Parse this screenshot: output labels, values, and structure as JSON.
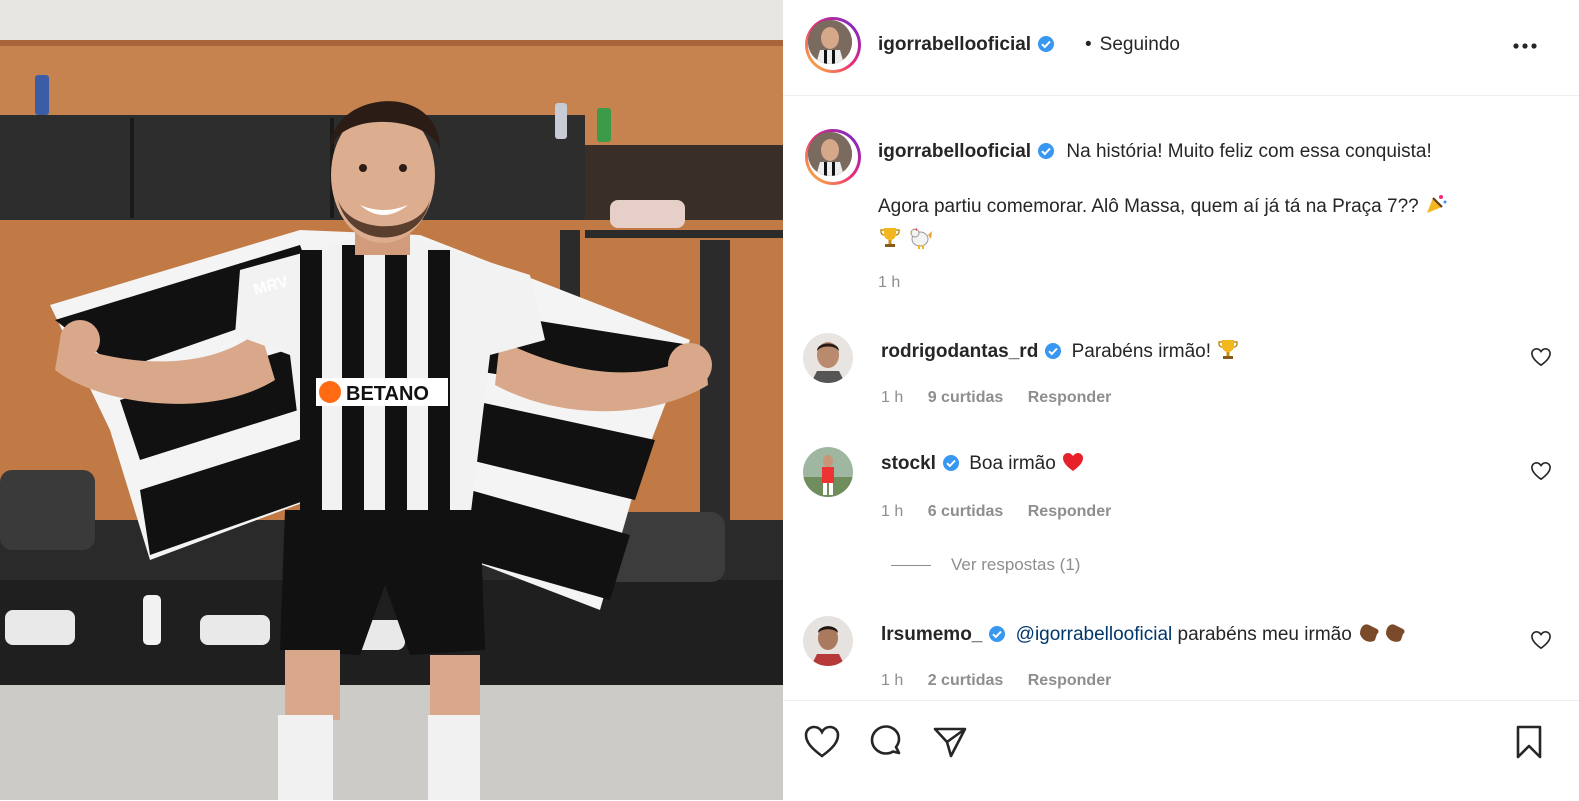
{
  "post": {
    "author": "igorrabellooficial",
    "follow_status": "Seguindo",
    "dot": "•",
    "caption_line1": "Na história! Muito feliz com essa conquista!",
    "caption_line2": "Agora partiu comemorar. Alô Massa, quem aí já tá na Praça 7??",
    "caption_emojis": [
      "party-popper-icon",
      "trophy-icon",
      "rooster-icon"
    ],
    "time": "1 h"
  },
  "photo": {
    "description_icon": "photo-icon",
    "jersey_brand": "BETANO",
    "sleeve_brand": "MRV"
  },
  "comments": [
    {
      "user": "rodrigodantas_rd",
      "text": "Parabéns irmão!",
      "emoji": "trophy-icon",
      "time": "1 h",
      "likes": "9 curtidas",
      "reply": "Responder"
    },
    {
      "user": "stockl",
      "text": "Boa irmão",
      "emoji": "red-heart-icon",
      "time": "1 h",
      "likes": "6 curtidas",
      "reply": "Responder"
    },
    {
      "user": "lrsumemo_",
      "mention": "@igorrabellooficial",
      "text": "parabéns meu irmão",
      "emoji": "clapping-hands-icon",
      "time": "1 h",
      "likes": "2 curtidas",
      "reply": "Responder"
    }
  ],
  "view_replies": "Ver respostas (1)",
  "colors": {
    "verified": "#3897f0",
    "mention": "#00376b",
    "muted": "#8e8e8e",
    "heart": "#ed4956"
  },
  "icons": [
    "more-options-icon",
    "like-icon",
    "comment-icon",
    "share-icon",
    "save-icon",
    "verified-badge-icon"
  ]
}
